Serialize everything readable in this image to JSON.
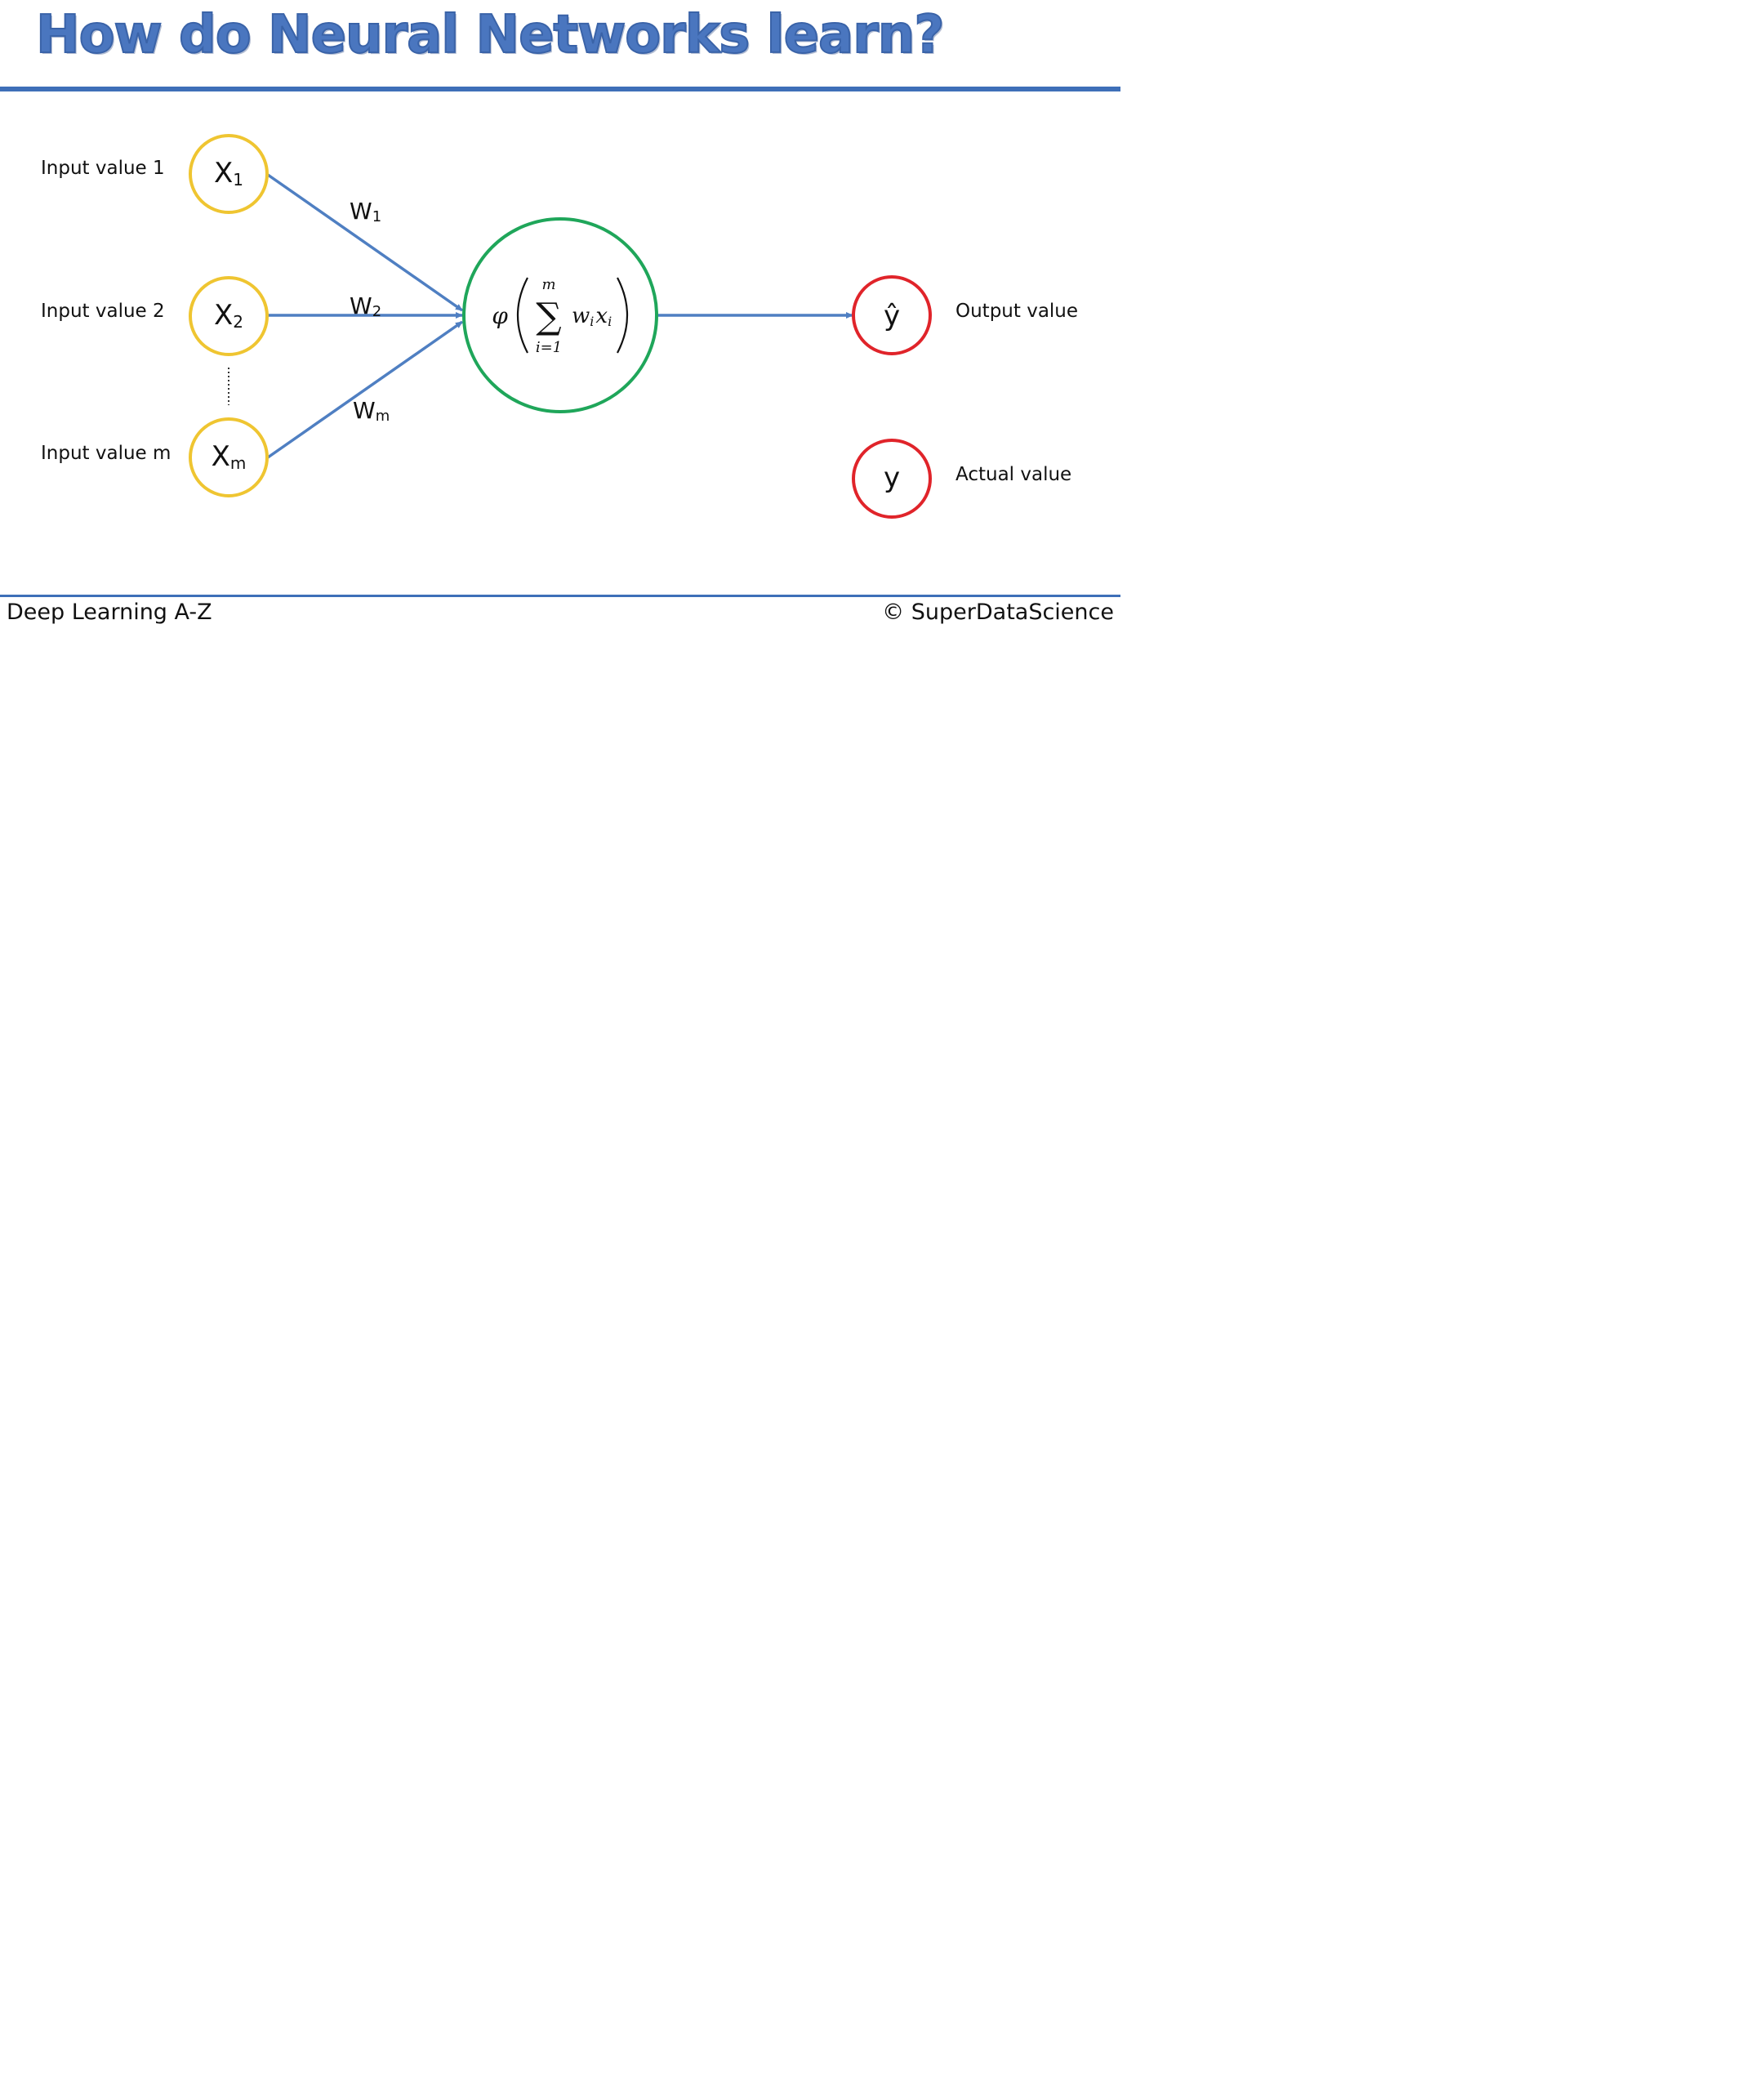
{
  "slide": {
    "title": "How do Neural Networks learn?",
    "footer_left": "Deep Learning A-Z",
    "footer_right": "© SuperDataScience"
  },
  "inputs": [
    {
      "label": "Input value 1",
      "node": "X",
      "sub": "1"
    },
    {
      "label": "Input value 2",
      "node": "X",
      "sub": "2"
    },
    {
      "label": "Input value m",
      "node": "X",
      "sub": "m"
    }
  ],
  "weights": [
    {
      "letter": "W",
      "sub": "1"
    },
    {
      "letter": "W",
      "sub": "2"
    },
    {
      "letter": "W",
      "sub": "m"
    }
  ],
  "neuron": {
    "phi": "φ",
    "sum_symbol": "∑",
    "upper": "m",
    "lower": "i=1",
    "term_w": "w",
    "term_x": "x",
    "term_sub": "i"
  },
  "outputs": {
    "predicted_symbol": "ŷ",
    "predicted_label": "Output value",
    "actual_symbol": "y",
    "actual_label": "Actual value"
  },
  "colors": {
    "title": "#4a76bf",
    "rule": "#3e6fb8",
    "edge": "#4f7fc2",
    "input_node": "#efc531",
    "neuron": "#1fa65a",
    "output_node": "#e0242a"
  }
}
